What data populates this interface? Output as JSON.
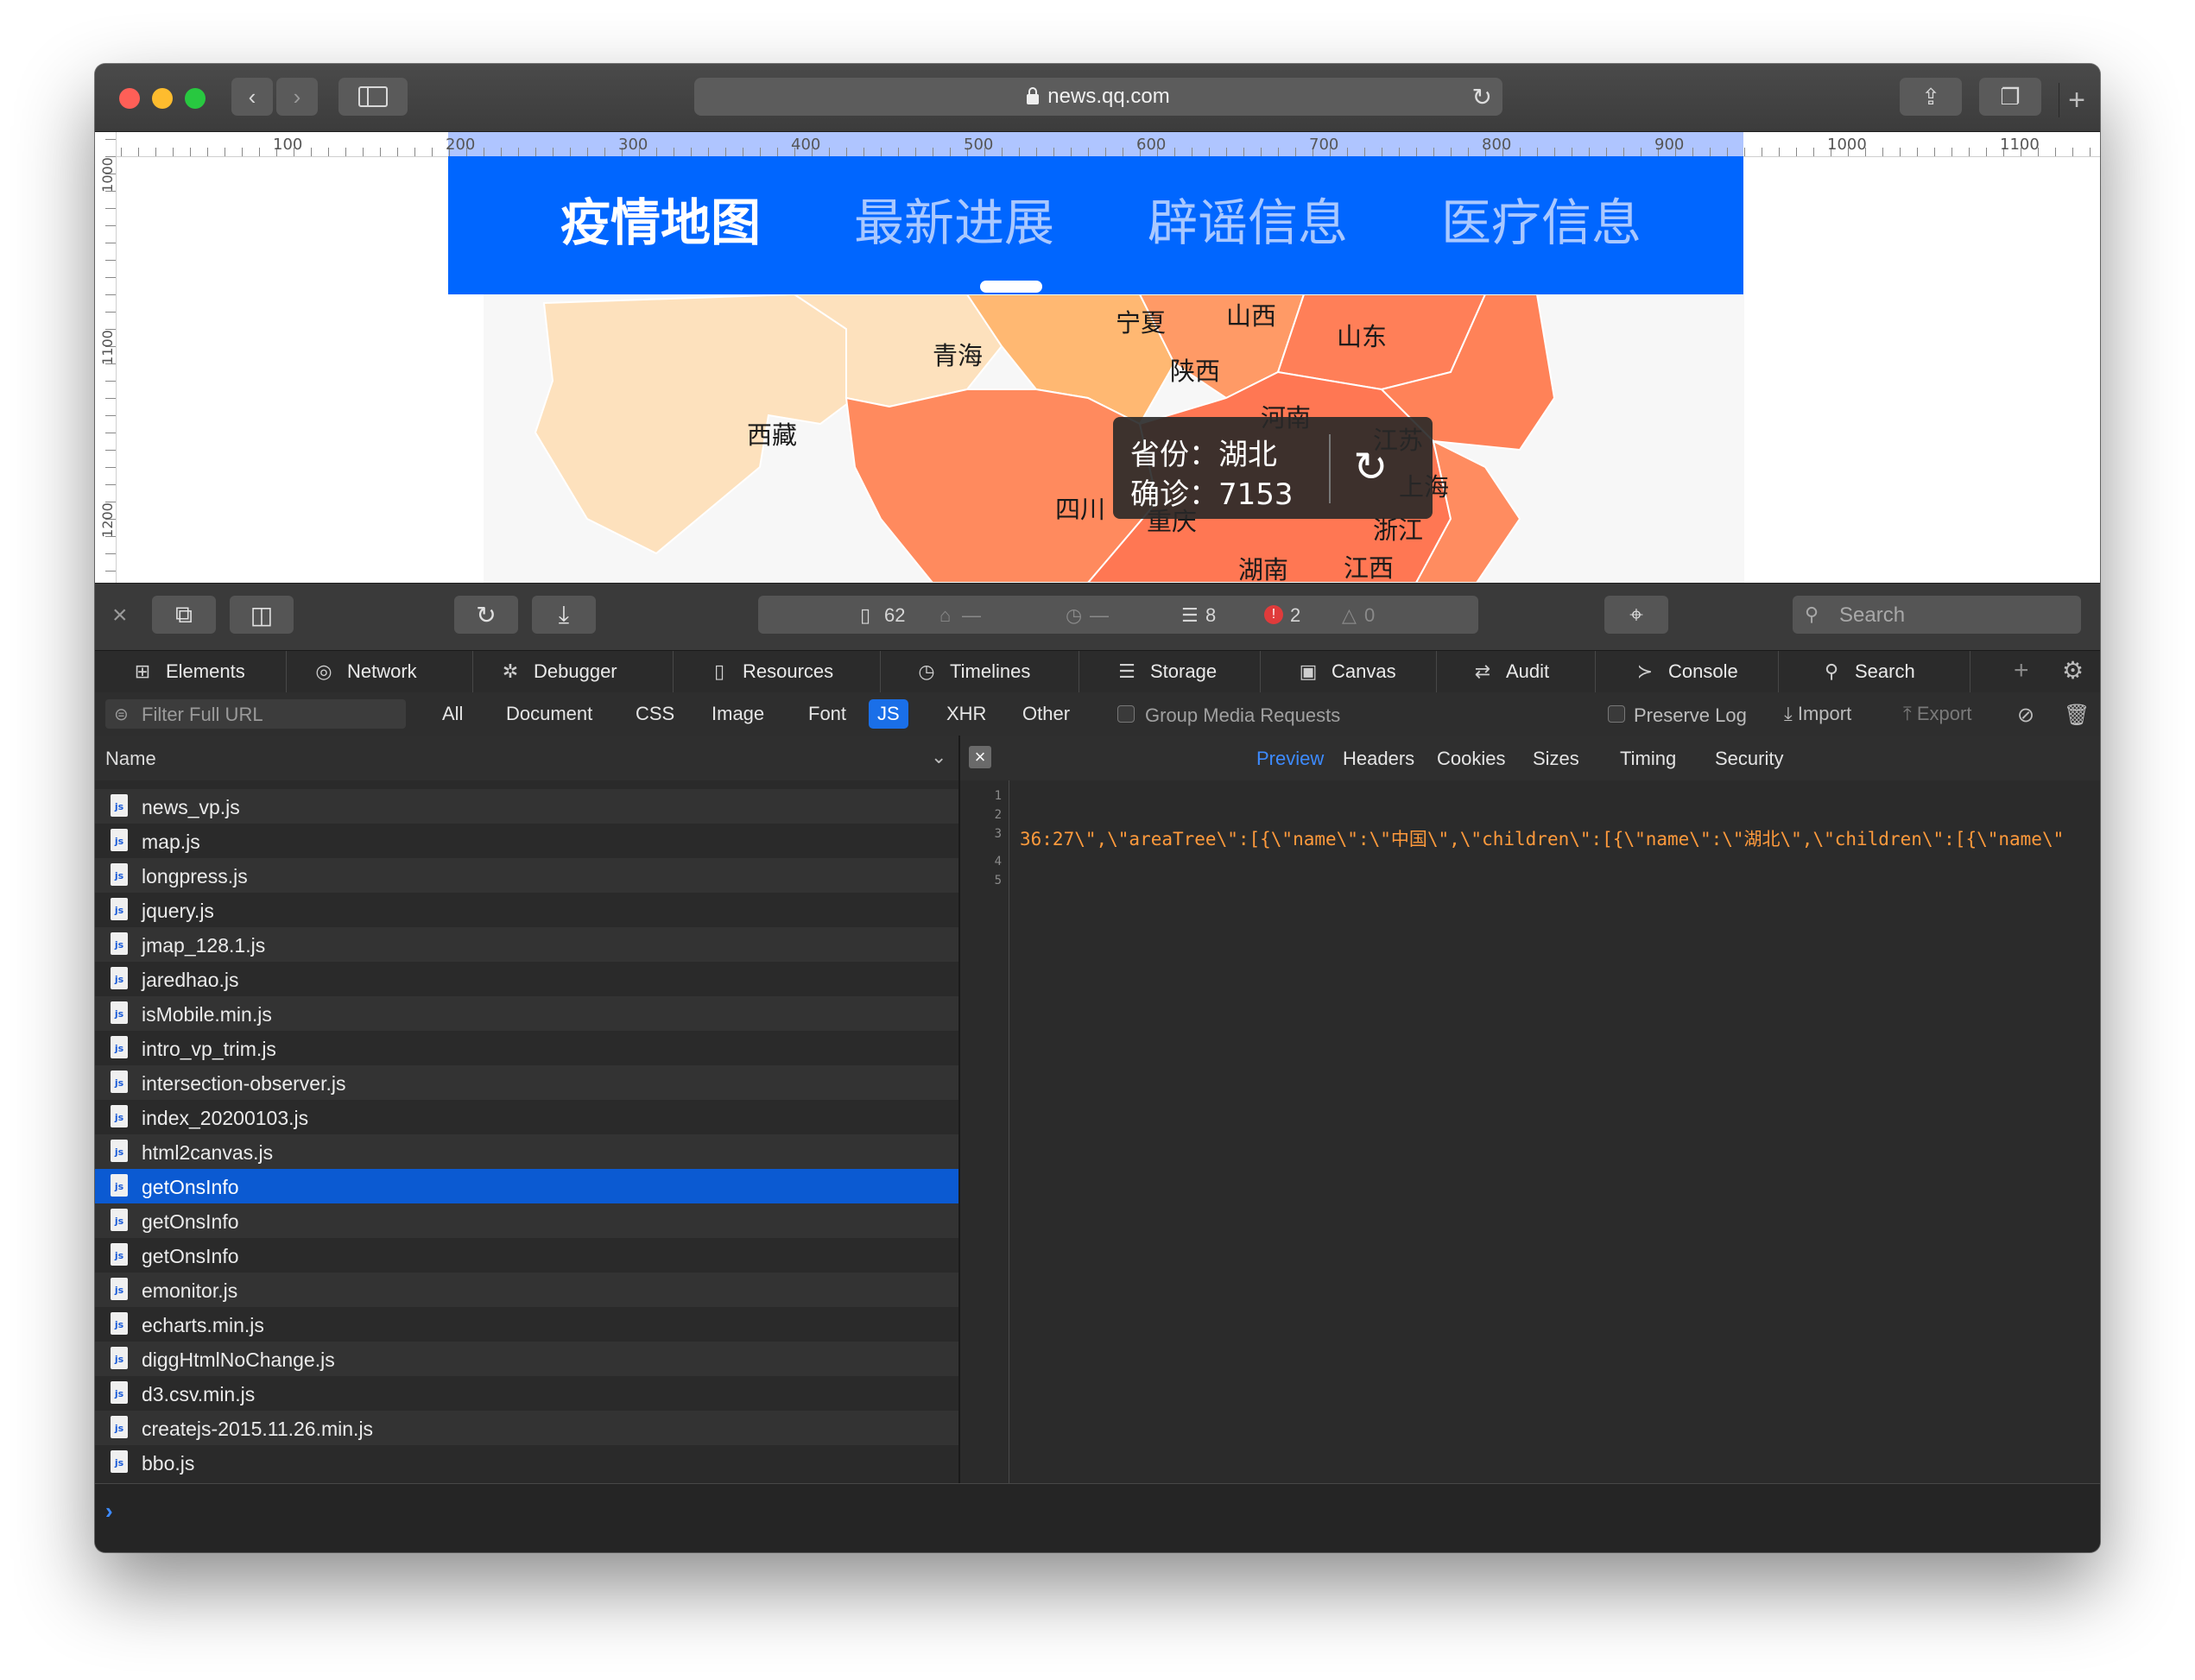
{
  "browser": {
    "url": "news.qq.com",
    "back_icon": "chevron-left-icon",
    "forward_icon": "chevron-right-icon"
  },
  "ruler": {
    "top_labels": [
      "100",
      "200",
      "300",
      "400",
      "500",
      "600",
      "700",
      "800",
      "900",
      "1000",
      "1100"
    ],
    "left_labels": [
      "1000",
      "1100",
      "1200"
    ]
  },
  "webpage": {
    "nav_tabs": [
      "疫情地图",
      "最新进展",
      "辟谣信息",
      "医疗信息"
    ],
    "map_labels": [
      "宁夏",
      "山西",
      "山东",
      "青海",
      "陕西",
      "西藏",
      "河南",
      "江苏",
      "四川",
      "重庆",
      "上海",
      "浙江",
      "湖南",
      "江西"
    ],
    "tooltip": {
      "province": "省份：湖北",
      "confirmed": "确诊：7153"
    },
    "colors": {
      "nav_bg": "#0066ff"
    }
  },
  "devtools": {
    "toolbar": {
      "resources_count": "62",
      "size": "—",
      "time": "—",
      "logs": "8",
      "errors": "2",
      "warnings": "0",
      "search_placeholder": "Search"
    },
    "tabs": [
      "Elements",
      "Network",
      "Debugger",
      "Resources",
      "Timelines",
      "Storage",
      "Canvas",
      "Audit",
      "Console",
      "Search"
    ],
    "filter": {
      "placeholder": "Filter Full URL",
      "types": [
        "All",
        "Document",
        "CSS",
        "Image",
        "Font",
        "JS",
        "XHR",
        "Other"
      ],
      "active_type": "JS",
      "group_media": "Group Media Requests",
      "preserve_log": "Preserve Log",
      "import": "Import",
      "export": "Export"
    },
    "list": {
      "header": "Name",
      "items": [
        "news_vp.js",
        "map.js",
        "longpress.js",
        "jquery.js",
        "jmap_128.1.js",
        "jaredhao.js",
        "isMobile.min.js",
        "intro_vp_trim.js",
        "intersection-observer.js",
        "index_20200103.js",
        "html2canvas.js",
        "getOnsInfo",
        "getOnsInfo",
        "getOnsInfo",
        "emonitor.js",
        "echarts.min.js",
        "diggHtmlNoChange.js",
        "d3.csv.min.js",
        "createjs-2015.11.26.min.js",
        "bbo.js"
      ],
      "selected_index": 11
    },
    "detail": {
      "tabs": [
        "Preview",
        "Headers",
        "Cookies",
        "Sizes",
        "Timing",
        "Security"
      ],
      "active_tab": "Preview",
      "line_numbers": [
        "1",
        "2",
        "3",
        "4",
        "5"
      ],
      "code_line": "36:27\\\",\\\"areaTree\\\":[{\\\"name\\\":\\\"中国\\\",\\\"children\\\":[{\\\"name\\\":\\\"湖北\\\",\\\"children\\\":[{\\\"name\\\""
    }
  }
}
